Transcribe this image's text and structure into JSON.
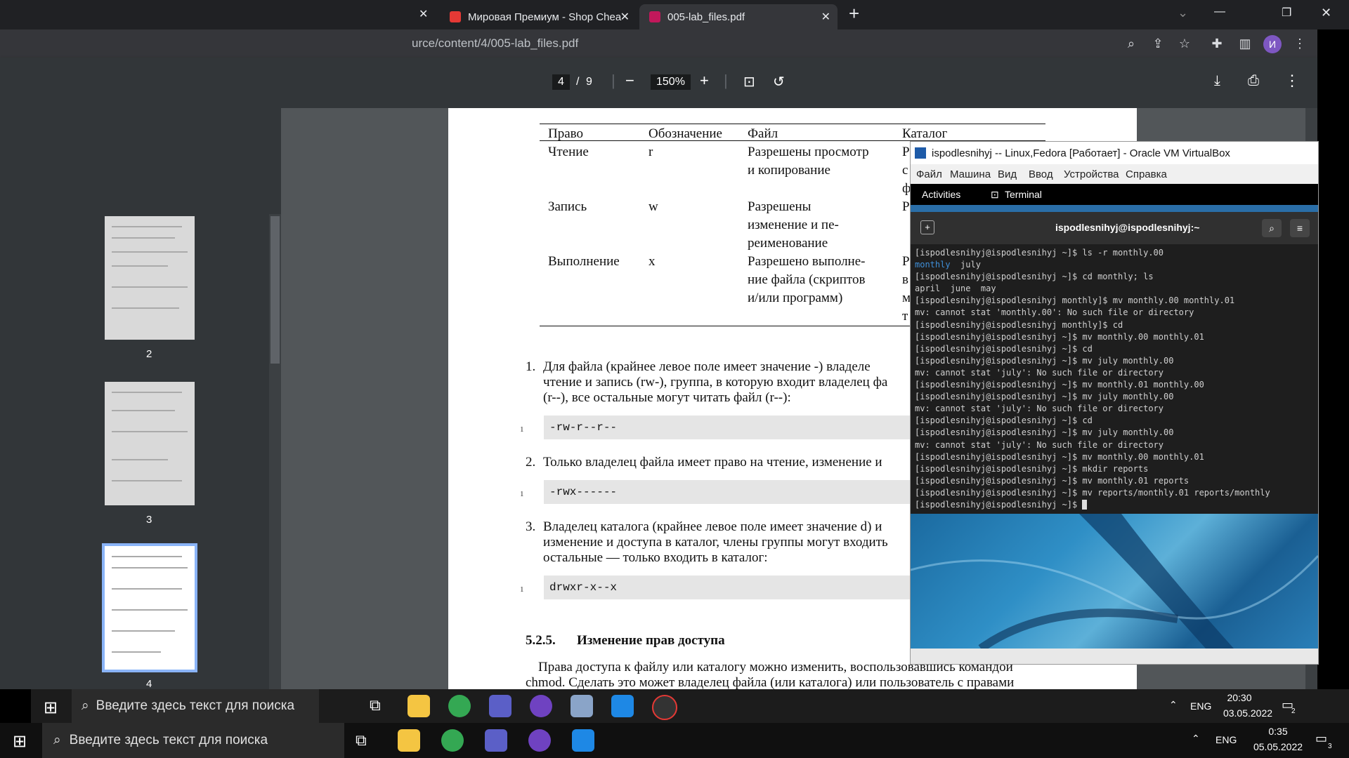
{
  "browser": {
    "tabs": [
      {
        "title": "Мировая Премиум - Shop Chea",
        "close": "✕"
      },
      {
        "title": "005-lab_files.pdf",
        "close": "✕"
      }
    ],
    "first_tab_close": "✕",
    "new_tab": "+",
    "window_controls": {
      "dropdown": "⌄",
      "minimize": "—",
      "restore": "❐",
      "close": "✕"
    },
    "url": "urce/content/4/005-lab_files.pdf",
    "profile_initial": "И"
  },
  "pdf_toolbar": {
    "page_current": "4",
    "page_sep": "/",
    "page_total": "9",
    "zoom": "150%",
    "zoom_out": "−",
    "zoom_in": "+"
  },
  "thumbnails": [
    {
      "label": "2"
    },
    {
      "label": "3"
    },
    {
      "label": "4"
    }
  ],
  "document": {
    "table_headers": [
      "Право",
      "Обозначение",
      "Файл",
      "Каталог"
    ],
    "rows": [
      {
        "right": "Чтение",
        "sym": "r",
        "file_lines": [
          "Разрешены просмотр",
          "и копирование"
        ],
        "dir": [
          "Р",
          "с",
          "ф"
        ]
      },
      {
        "right": "Запись",
        "sym": "w",
        "file_lines": [
          "Разрешены",
          "изменение и пе-",
          "реименование"
        ],
        "dir": [
          "Р"
        ]
      },
      {
        "right": "Выполнение",
        "sym": "x",
        "file_lines": [
          "Разрешено выполне-",
          "ние файла (скриптов",
          "и/или программ)"
        ],
        "dir": [
          "Р",
          "в",
          "м",
          "т"
        ]
      }
    ],
    "item1_num": "1.",
    "item1_lines": [
      "Для файла (крайнее левое поле имеет значение -) владеле",
      "чтение и запись (rw-), группа, в которую входит владелец фа",
      "(r--), все остальные могут читать файл (r--):"
    ],
    "code1": "-rw-r--r--",
    "item2_num": "2.",
    "item2": "Только владелец файла имеет право на чтение, изменение и",
    "code2": "-rwx------",
    "item3_num": "3.",
    "item3_lines": [
      "Владелец каталога (крайнее левое поле имеет значение d) и",
      "изменение и доступа в каталог, члены группы могут входить",
      "остальные — только входить в каталог:"
    ],
    "code3": "drwxr-x--x",
    "code_line_no": "1",
    "section_num": "5.2.5.",
    "section_title": "Изменение прав доступа",
    "para_lines": [
      "Права доступа к файлу или каталогу можно изменить, воспользовавшись командой",
      "chmod. Сделать это может владелец файла (или каталога) или пользователь с правами"
    ]
  },
  "vbox": {
    "title": "ispodlesnihyj -- Linux,Fedora [Работает] - Oracle VM VirtualBox",
    "menu": [
      "Файл",
      "Машина",
      "Вид",
      "Ввод",
      "Устройства",
      "Справка"
    ],
    "activities": "Activities",
    "terminal_app": "Terminal",
    "terminal_title": "ispodlesnihyj@ispodlesnihyj:~",
    "terminal_lines": [
      "[ispodlesnihyj@ispodlesnihyj ~]$ ls -r monthly.00",
      "monthly  july",
      "[ispodlesnihyj@ispodlesnihyj ~]$ cd monthly; ls",
      "april  june  may",
      "[ispodlesnihyj@ispodlesnihyj monthly]$ mv monthly.00 monthly.01",
      "mv: cannot stat 'monthly.00': No such file or directory",
      "[ispodlesnihyj@ispodlesnihyj monthly]$ cd",
      "[ispodlesnihyj@ispodlesnihyj ~]$ mv monthly.00 monthly.01",
      "[ispodlesnihyj@ispodlesnihyj ~]$ cd",
      "[ispodlesnihyj@ispodlesnihyj ~]$ mv july monthly.00",
      "mv: cannot stat 'july': No such file or directory",
      "[ispodlesnihyj@ispodlesnihyj ~]$ mv monthly.01 monthly.00",
      "[ispodlesnihyj@ispodlesnihyj ~]$ mv july monthly.00",
      "mv: cannot stat 'july': No such file or directory",
      "[ispodlesnihyj@ispodlesnihyj ~]$ cd",
      "[ispodlesnihyj@ispodlesnihyj ~]$ mv july monthly.00",
      "mv: cannot stat 'july': No such file or directory",
      "[ispodlesnihyj@ispodlesnihyj ~]$ mv monthly.00 monthly.01",
      "[ispodlesnihyj@ispodlesnihyj ~]$ mkdir reports",
      "[ispodlesnihyj@ispodlesnihyj ~]$ mv monthly.01 reports",
      "[ispodlesnihyj@ispodlesnihyj ~]$ mv reports/monthly.01 reports/monthly",
      "[ispodlesnihyj@ispodlesnihyj ~]$ "
    ]
  },
  "taskbar_inner": {
    "search_placeholder": "Введите здесь текст для поиска",
    "lang": "ENG",
    "time": "20:30",
    "date": "03.05.2022",
    "notif_count": "2"
  },
  "taskbar_outer": {
    "search_placeholder": "Введите здесь текст для поиска",
    "lang": "ENG",
    "time": "0:35",
    "date": "05.05.2022",
    "notif_count": "3"
  },
  "colors": {
    "chrome_bg": "#202124",
    "terminal_bg": "#1e1e1e",
    "terminal_dir": "#3f8fd8",
    "taskbar": "#101010"
  }
}
